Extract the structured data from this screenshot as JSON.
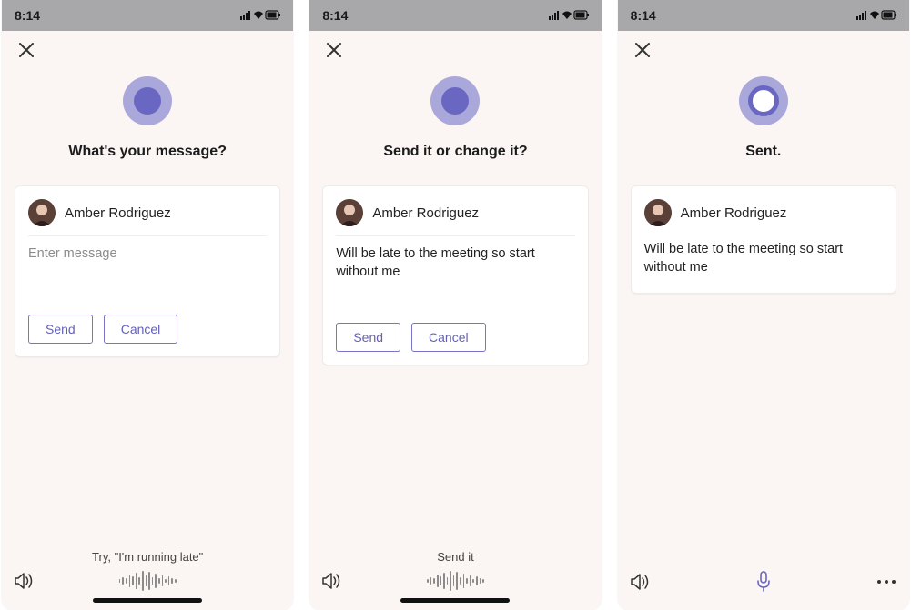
{
  "status": {
    "time": "8:14"
  },
  "screens": [
    {
      "prompt": "What's your message?",
      "recipient": "Amber Rodriguez",
      "message_placeholder": "Enter message",
      "message": "",
      "buttons": {
        "send": "Send",
        "cancel": "Cancel"
      },
      "footer_hint": "Try, \"I'm running late\"",
      "footer_mode": "wave",
      "orb": "solid"
    },
    {
      "prompt": "Send it or change it?",
      "recipient": "Amber Rodriguez",
      "message": "Will be late to the meeting so start without me",
      "buttons": {
        "send": "Send",
        "cancel": "Cancel"
      },
      "footer_hint": "Send it",
      "footer_mode": "wave",
      "orb": "solid"
    },
    {
      "prompt": "Sent.",
      "recipient": "Amber Rodriguez",
      "message": "Will be late to the meeting so start without me",
      "buttons": null,
      "footer_hint": "",
      "footer_mode": "mic",
      "orb": "ring"
    }
  ],
  "colors": {
    "accent": "#6967c2",
    "accent_light": "#aaa8da"
  }
}
